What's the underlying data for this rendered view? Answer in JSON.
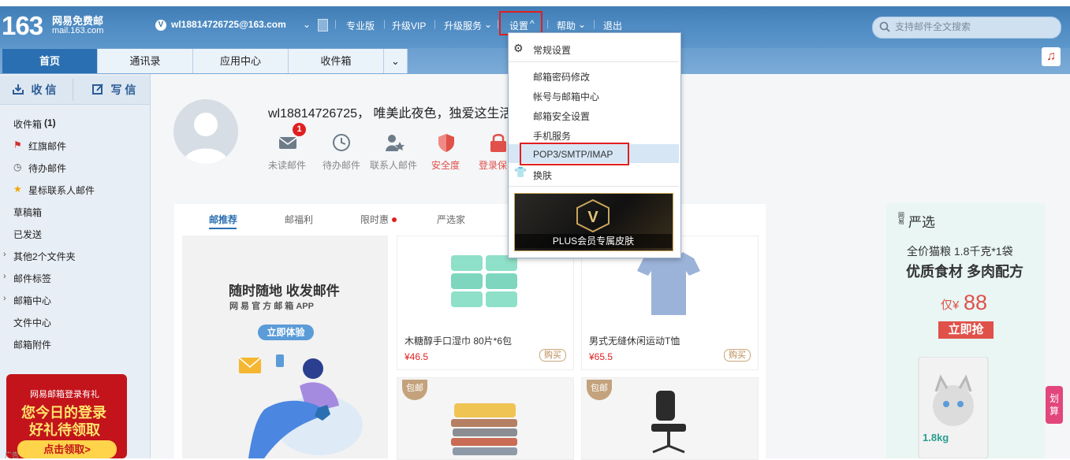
{
  "logo": {
    "num": "163",
    "cn": "网易免费邮",
    "en": "mail.163.com"
  },
  "header": {
    "account": "wl18814726725@163.com",
    "links": [
      "专业版",
      "升级VIP",
      "升级服务",
      "设置",
      "帮助",
      "退出"
    ],
    "search_placeholder": "支持邮件全文搜索"
  },
  "tabs": [
    "首页",
    "通讯录",
    "应用中心",
    "收件箱"
  ],
  "sidebar": {
    "receive": "收 信",
    "write": "写 信",
    "items": [
      "收件箱",
      "(1)",
      "红旗邮件",
      "待办邮件",
      "星标联系人邮件",
      "草稿箱",
      "已发送",
      "其他2个文件夹",
      "邮件标签",
      "邮箱中心",
      "文件中心",
      "邮箱附件"
    ]
  },
  "profile": {
    "greeting": "wl18814726725， 唯美此夜色，独爱这生活",
    "badge": "1",
    "quick": [
      "未读邮件",
      "待办邮件",
      "联系人邮件",
      "安全度",
      "登录保"
    ]
  },
  "recommend": {
    "tabs": [
      "邮推荐",
      "邮福利",
      "限时惠",
      "严选家"
    ],
    "promo_title": "随时随地 收发邮件",
    "promo_sub": "网 易 官 方 邮 箱 APP",
    "promo_btn": "立即体验",
    "products": [
      {
        "name": "木糖醇手口湿巾 80片*6包",
        "price": "¥46.5",
        "buy": "购买"
      },
      {
        "name": "男式无缝休闲运动T恤",
        "price": "¥65.5",
        "buy": "购买"
      }
    ],
    "tag": "包邮"
  },
  "menu": {
    "items": [
      "常规设置",
      "邮箱密码修改",
      "帐号与邮箱中心",
      "邮箱安全设置",
      "手机服务",
      "POP3/SMTP/IMAP",
      "换肤"
    ],
    "banner": "PLUS会员专属皮肤"
  },
  "ad": {
    "brand": "严选",
    "brand_small": "网易",
    "line1": "全价猫粮 1.8千克*1袋",
    "line2": "优质食材 多肉配方",
    "price_pre": "仅¥",
    "price": "88",
    "cta": "立即抢",
    "weight": "1.8kg"
  },
  "lower_ad": {
    "top": "网易邮箱登录有礼",
    "l1": "您今日的登录",
    "l2": "好礼待领取",
    "cta": "点击领取>",
    "tag": "广告"
  },
  "side_widget": "划算",
  "colors": {
    "header": "#3c78b0",
    "active_tab": "#2a6fb2",
    "highlight": "#e02020",
    "menu_sel": "#d6e6f5"
  }
}
